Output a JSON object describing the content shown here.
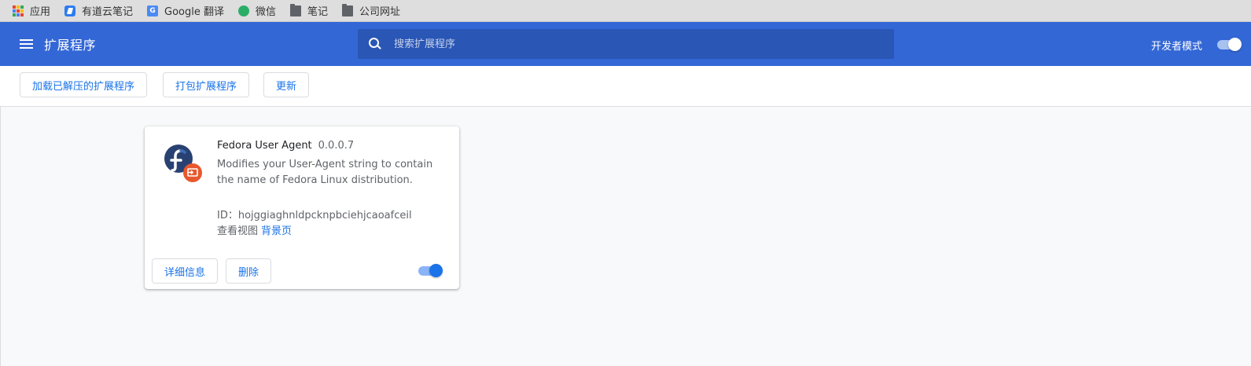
{
  "bookmarks": [
    {
      "label": "应用",
      "icon": "apps-grid-icon"
    },
    {
      "label": "有道云笔记",
      "icon": "youdao-note-icon"
    },
    {
      "label": "Google 翻译",
      "icon": "google-translate-icon"
    },
    {
      "label": "微信",
      "icon": "wechat-icon"
    },
    {
      "label": "笔记",
      "icon": "folder-icon"
    },
    {
      "label": "公司网址",
      "icon": "folder-icon"
    }
  ],
  "header": {
    "title": "扩展程序",
    "search_placeholder": "搜索扩展程序",
    "dev_mode_label": "开发者模式",
    "dev_mode_on": true
  },
  "toolbar": {
    "load_unpacked": "加载已解压的扩展程序",
    "pack": "打包扩展程序",
    "update": "更新"
  },
  "extension": {
    "name": "Fedora User Agent",
    "version": "0.0.0.7",
    "description": "Modifies your User-Agent string to contain the name of Fedora Linux distribution.",
    "id_label": "ID：",
    "id": "hojggiaghnldpcknpbciehjcaoafceil",
    "views_label": "查看视图",
    "views_link": "背景页",
    "details_button": "详细信息",
    "remove_button": "删除",
    "enabled": true
  },
  "colors": {
    "header_bg": "#3367d6",
    "accent": "#1a73e8",
    "fedora_blue": "#294172",
    "badge_orange": "#e8582e"
  }
}
